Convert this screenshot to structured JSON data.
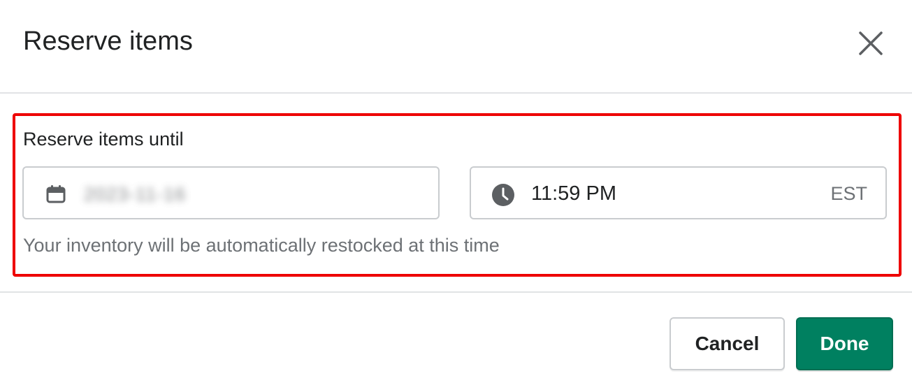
{
  "modal": {
    "title": "Reserve items",
    "close_icon": "close-icon"
  },
  "reserve": {
    "label": "Reserve items until",
    "date": {
      "icon": "calendar-icon",
      "value": "2023-11-16"
    },
    "time": {
      "icon": "clock-icon",
      "value": "11:59 PM",
      "timezone": "EST"
    },
    "help_text": "Your inventory will be automatically restocked at this time"
  },
  "footer": {
    "cancel_label": "Cancel",
    "done_label": "Done"
  },
  "colors": {
    "primary": "#008060",
    "highlight": "#ee0000",
    "border": "#c9cccf",
    "subdued_text": "#6d7175"
  }
}
